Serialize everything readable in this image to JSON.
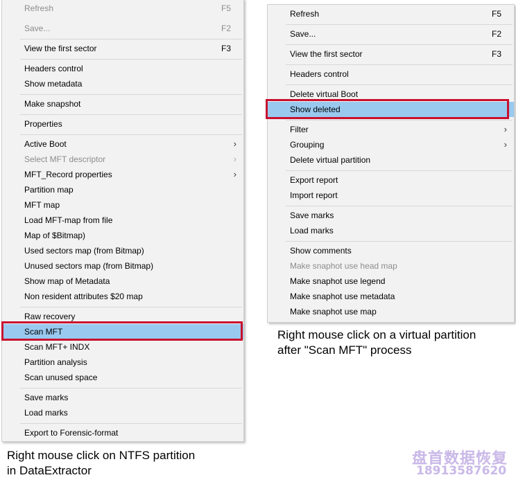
{
  "left_menu": {
    "items": [
      {
        "label": "Refresh",
        "shortcut": "F5",
        "disabled": true
      },
      {
        "label": "Save...",
        "shortcut": "F2",
        "disabled": true
      },
      {
        "label": "View the first sector",
        "shortcut": "F3"
      },
      {
        "label": "Headers control"
      },
      {
        "label": "Show metadata"
      },
      {
        "label": "Make snapshot"
      },
      {
        "label": "Properties"
      },
      {
        "label": "Active Boot",
        "submenu": true
      },
      {
        "label": "Select MFT descriptor",
        "submenu": true,
        "disabled": true
      },
      {
        "label": "MFT_Record properties",
        "submenu": true
      },
      {
        "label": "Partition map"
      },
      {
        "label": "MFT map"
      },
      {
        "label": "Load MFT-map from file"
      },
      {
        "label": "Map of $Bitmap)"
      },
      {
        "label": "Used sectors map (from Bitmap)"
      },
      {
        "label": "Unused sectors map (from Bitmap)"
      },
      {
        "label": "Show map of Metadata"
      },
      {
        "label": "Non resident attributes $20 map"
      },
      {
        "label": "Raw recovery"
      },
      {
        "label": "Scan MFT",
        "highlighted": true
      },
      {
        "label": "Scan MFT+ INDX"
      },
      {
        "label": "Partition analysis"
      },
      {
        "label": "Scan unused space"
      },
      {
        "label": "Save marks"
      },
      {
        "label": "Load marks"
      },
      {
        "label": "Export to Forensic-format"
      }
    ]
  },
  "right_menu": {
    "items": [
      {
        "label": "Refresh",
        "shortcut": "F5"
      },
      {
        "label": "Save...",
        "shortcut": "F2"
      },
      {
        "label": "View the first sector",
        "shortcut": "F3"
      },
      {
        "label": "Headers control"
      },
      {
        "label": "Delete virtual Boot"
      },
      {
        "label": "Show deleted",
        "highlighted": true
      },
      {
        "label": "Filter",
        "submenu": true
      },
      {
        "label": "Grouping",
        "submenu": true
      },
      {
        "label": "Delete virtual partition"
      },
      {
        "label": "Export report"
      },
      {
        "label": "Import report"
      },
      {
        "label": "Save marks"
      },
      {
        "label": "Load marks"
      },
      {
        "label": "Show comments"
      },
      {
        "label": "Make snaphot use head map",
        "disabled": true
      },
      {
        "label": "Make snaphot use legend"
      },
      {
        "label": "Make snaphot use metadata"
      },
      {
        "label": "Make snaphot use map"
      }
    ]
  },
  "captions": {
    "left_line1": "Right mouse click on NTFS partition",
    "left_line2": "in DataExtractor",
    "right_line1": "Right mouse click on a virtual partition",
    "right_line2": "after \"Scan MFT\" process"
  },
  "watermark": {
    "brand": "盘首数据恢复",
    "phone": "18913587620"
  },
  "colors": {
    "menu_bg": "#f2f2f2",
    "highlight": "#99c9ef",
    "annotation_red": "#c8102e",
    "disabled_text": "#8c8c8c"
  }
}
